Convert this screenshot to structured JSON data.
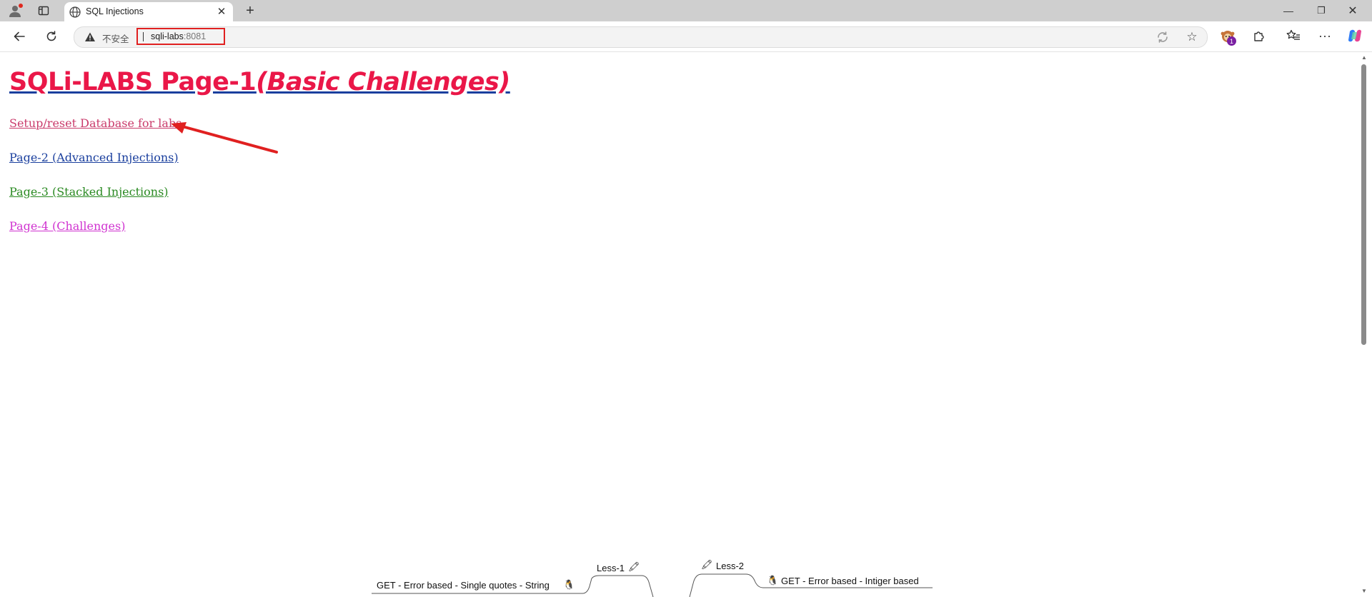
{
  "browser": {
    "tab_title": "SQL Injections",
    "tab_close": "✕",
    "new_tab": "+",
    "window": {
      "minimize": "—",
      "maximize": "❐",
      "close": "✕"
    },
    "address_bar": {
      "security_label": "不安全",
      "host": "sqli-labs",
      "port": ":8081"
    },
    "extension_badge": "1",
    "more": "···",
    "icons": [
      "profile-icon",
      "tab-actions-icon",
      "globe-icon",
      "back-icon",
      "reload-icon",
      "warning-icon",
      "translate-icon",
      "star-icon",
      "extension-icon",
      "puzzle-icon",
      "favorites-icon",
      "more-icon",
      "copilot-icon"
    ]
  },
  "page": {
    "heading": "SQLi-LABS Page-1",
    "heading_sub": "(Basic Challenges)",
    "links": {
      "setup": "Setup/reset Database for labs",
      "page2": "Page-2 (Advanced Injections)",
      "page3": "Page-3 (Stacked Injections)",
      "page4": "Page-4 (Challenges)"
    },
    "colors": {
      "heading": "#ea1748",
      "setup": "#ca3c6c",
      "page2": "#1a3f9e",
      "page3": "#2a8a22",
      "page4": "#d033d0",
      "annotation": "#e02020"
    },
    "mindmap": {
      "less1": "Less-1",
      "less1_desc": "GET - Error based - Single quotes - String",
      "less2": "Less-2",
      "less2_desc": "GET - Error based - Intiger based"
    }
  }
}
